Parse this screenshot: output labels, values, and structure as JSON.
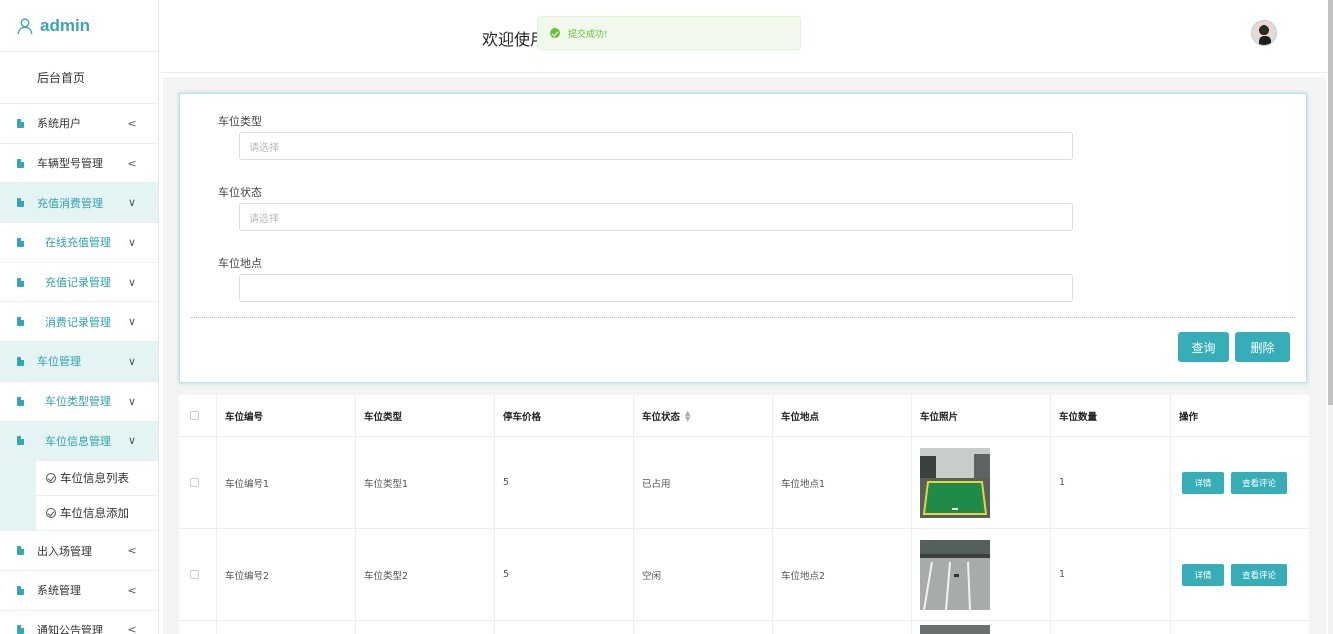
{
  "brand": {
    "title": "admin",
    "icon": "user-icon"
  },
  "sidebar": {
    "home": "后台首页",
    "items": [
      {
        "label": "系统用户",
        "chevron": "<"
      },
      {
        "label": "车辆型号管理",
        "chevron": "<"
      },
      {
        "label": "充值消费管理",
        "chevron": "∨"
      },
      {
        "label": "在线充值管理",
        "chevron": "∨"
      },
      {
        "label": "充值记录管理",
        "chevron": "∨"
      },
      {
        "label": "消费记录管理",
        "chevron": "∨"
      },
      {
        "label": "车位管理",
        "chevron": "∨"
      },
      {
        "label": "车位类型管理",
        "chevron": "∨"
      },
      {
        "label": "车位信息管理",
        "chevron": "∨"
      },
      {
        "label": "出入场管理",
        "chevron": "<"
      },
      {
        "label": "系统管理",
        "chevron": "<"
      },
      {
        "label": "通知公告管理",
        "chevron": "<"
      }
    ],
    "leaves": [
      {
        "label": "车位信息列表"
      },
      {
        "label": "车位信息添加"
      }
    ]
  },
  "header": {
    "welcome": "欢迎使用",
    "toast": "提交成功!"
  },
  "search": {
    "type_label": "车位类型",
    "type_placeholder": "请选择",
    "status_label": "车位状态",
    "status_placeholder": "请选择",
    "location_label": "车位地点",
    "location_value": "",
    "query_button": "查询",
    "delete_button": "删除"
  },
  "table": {
    "headers": [
      "车位编号",
      "车位类型",
      "停车价格",
      "车位状态",
      "车位地点",
      "车位照片",
      "车位数量",
      "操作"
    ],
    "rows": [
      {
        "code": "车位编号1",
        "type": "车位类型1",
        "price": "5",
        "status": "已占用",
        "location": "车位地点1",
        "qty": "1",
        "detail": "详情",
        "review": "查看评论"
      },
      {
        "code": "车位编号2",
        "type": "车位类型2",
        "price": "5",
        "status": "空闲",
        "location": "车位地点2",
        "qty": "1",
        "detail": "详情",
        "review": "查看评论"
      }
    ]
  },
  "colors": {
    "accent": "#36adb7",
    "success": "#67c23a",
    "active_bg": "#e4f4f4"
  }
}
